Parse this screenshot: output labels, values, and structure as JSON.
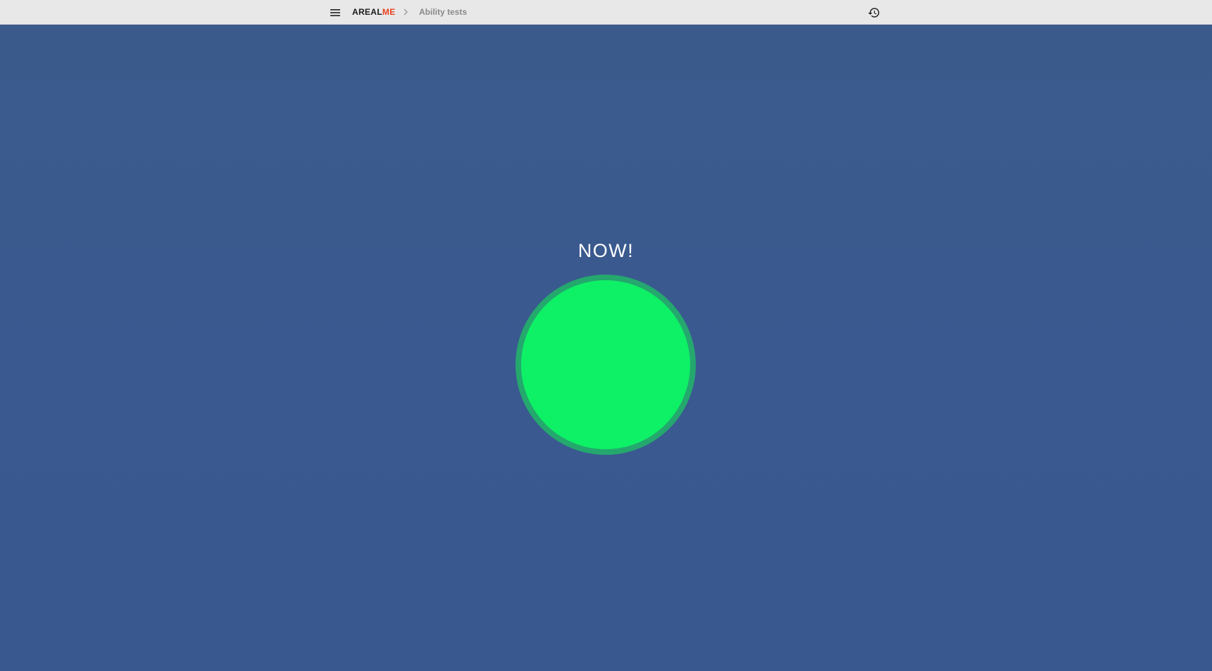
{
  "header": {
    "logo_main": "AREAL",
    "logo_accent": "ME",
    "breadcrumb": "Ability tests",
    "menu_icon": "hamburger-menu-icon",
    "separator_icon": "chevron-right-icon",
    "history_icon": "history-icon"
  },
  "test": {
    "prompt": "NOW!",
    "target_color": "#0ef066",
    "target_border_color": "#24a86e"
  },
  "colors": {
    "background": "#3a5a8f",
    "topbar": "#e8e8e8",
    "accent": "#e8411f"
  }
}
